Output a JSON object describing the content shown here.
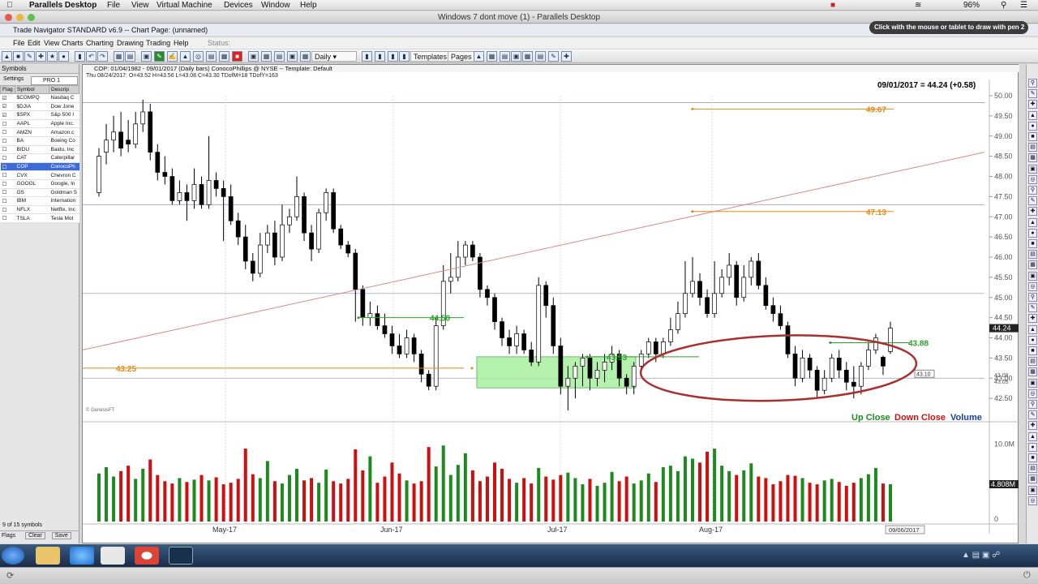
{
  "mac_menubar": {
    "app": "Parallels Desktop",
    "items": [
      "File",
      "View",
      "Virtual Machine",
      "Devices",
      "Window",
      "Help"
    ],
    "battery": "96%"
  },
  "parallels": {
    "window_title": "Windows 7 dont move (1) - Parallels Desktop"
  },
  "tn": {
    "title": "Trade Navigator STANDARD v6.9  --  Chart Page: (unnamed)",
    "hint": "Click with the mouse or tablet to draw with pen 2",
    "menus": [
      "File",
      "Edit",
      "View",
      "Charts",
      "Charting",
      "Drawing",
      "Trading",
      "Help"
    ],
    "status_label": "Status:",
    "period": "Daily",
    "templates_label": "Templates",
    "pages_label": "Pages"
  },
  "left_panel": {
    "header": "Symbols",
    "settings_label": "Settings",
    "list_name": "PRO 1",
    "columns": [
      "Flag",
      "Symbol",
      "Descrip"
    ],
    "rows": [
      {
        "symbol": "$COMPQ",
        "desc": "Nasdaq C",
        "flag": "☑"
      },
      {
        "symbol": "$DJIA",
        "desc": "Dow Jone",
        "flag": "☑"
      },
      {
        "symbol": "$SPX",
        "desc": "S&p 500 I",
        "flag": "☑"
      },
      {
        "symbol": "AAPL",
        "desc": "Apple Inc.",
        "flag": "☐"
      },
      {
        "symbol": "AMZN",
        "desc": "Amazon.c",
        "flag": "☐"
      },
      {
        "symbol": "BA",
        "desc": "Boeing Co",
        "flag": "☐"
      },
      {
        "symbol": "BIDU",
        "desc": "Baidu, Inc",
        "flag": "☐"
      },
      {
        "symbol": "CAT",
        "desc": "Caterpillar",
        "flag": "☐"
      },
      {
        "symbol": "COP",
        "desc": "ConocoPh",
        "flag": "☐"
      },
      {
        "symbol": "CVX",
        "desc": "Chevron C",
        "flag": "☐"
      },
      {
        "symbol": "GOOGL",
        "desc": "Google, In",
        "flag": "☐"
      },
      {
        "symbol": "GS",
        "desc": "Goldman S",
        "flag": "☐"
      },
      {
        "symbol": "IBM",
        "desc": "Internation",
        "flag": "☐"
      },
      {
        "symbol": "NFLX",
        "desc": "Netflix, Inc",
        "flag": "☐"
      },
      {
        "symbol": "TSLA",
        "desc": "Tesla Mot",
        "flag": "☐"
      }
    ],
    "selected_index": 8,
    "count_text": "9 of 15 symbols",
    "footer_buttons": [
      "Flags",
      "Clear",
      "Save"
    ]
  },
  "chart_window": {
    "header": "COP: 01/04/1982 - 09/01/2017 (Daily bars)  ConocoPhillips @ NYSE  --  Template: Default",
    "bar_info": "Thu  08/24/2017: O=43.52  H=43.56  L=43.08  C=43.30  TDofM=18  TDofY=163",
    "last_price_label": "09/01/2017 = 44.24 (+0.58)",
    "copyright": "© GenesisFT",
    "volume_legend": [
      "Up Close",
      "Down Close",
      "Volume"
    ],
    "date_readout": "09/06/2017"
  },
  "chart_data": {
    "type": "candlestick",
    "symbol": "COP",
    "price_axis": {
      "min": 42.0,
      "max": 50.0,
      "ticks": [
        "50.00",
        "49.50",
        "49.00",
        "48.50",
        "48.00",
        "47.50",
        "47.00",
        "46.50",
        "46.00",
        "45.50",
        "45.00",
        "44.50",
        "44.00",
        "43.50",
        "43.00",
        "42.50"
      ]
    },
    "x_ticks": [
      "May-17",
      "Jun-17",
      "Jul-17",
      "Aug-17"
    ],
    "last_price_tag": "44.24",
    "horizontal_levels": [
      {
        "label": "49.67",
        "value": 49.67,
        "color": "#e58a1a"
      },
      {
        "label": "47.13",
        "value": 47.13,
        "color": "#e58a1a"
      },
      {
        "label": "44.50",
        "value": 44.5,
        "color": "#2aa52a"
      },
      {
        "label": "43.25",
        "value": 43.25,
        "color": "#e58a1a"
      },
      {
        "label": "43.53",
        "value": 43.53,
        "color": "#2aa52a"
      },
      {
        "label": "43.88",
        "value": 43.88,
        "color": "#2aa52a"
      }
    ],
    "price_tags": [
      "43.10",
      "43.09",
      "43.05"
    ],
    "volume_axis": {
      "ticks": [
        "10.0M",
        "0"
      ],
      "last_volume_tag": "4.808M"
    },
    "colors": {
      "up": "#1e8a1e",
      "down": "#cc1010",
      "candle_up": "#ffffff",
      "candle_down": "#000000",
      "trendline": "#d88a8a",
      "ellipse": "#a83030",
      "zone": "#a8f0a0"
    },
    "candles": [
      [
        47.6,
        48.5,
        47.5,
        48.7
      ],
      [
        48.6,
        48.9,
        48.3,
        49.3
      ],
      [
        48.9,
        49.1,
        48.6,
        49.5
      ],
      [
        49.1,
        48.7,
        48.5,
        49.6
      ],
      [
        48.9,
        48.8,
        48.6,
        49.4
      ],
      [
        48.8,
        49.3,
        48.7,
        49.6
      ],
      [
        49.3,
        49.6,
        49.1,
        49.9
      ],
      [
        49.6,
        48.6,
        48.4,
        49.8
      ],
      [
        48.6,
        48.1,
        47.9,
        48.8
      ],
      [
        48.1,
        48.0,
        47.8,
        48.5
      ],
      [
        48.0,
        47.4,
        47.3,
        48.2
      ],
      [
        47.4,
        47.6,
        47.3,
        47.9
      ],
      [
        47.6,
        47.4,
        46.9,
        47.8
      ],
      [
        47.4,
        47.8,
        47.2,
        48.2
      ],
      [
        47.8,
        47.3,
        47.2,
        48.0
      ],
      [
        47.3,
        47.9,
        47.2,
        49.0
      ],
      [
        47.9,
        47.7,
        47.5,
        48.1
      ],
      [
        47.7,
        47.5,
        46.4,
        47.9
      ],
      [
        47.5,
        46.9,
        46.8,
        47.8
      ],
      [
        46.9,
        46.5,
        46.3,
        47.1
      ],
      [
        46.5,
        45.9,
        45.7,
        46.8
      ],
      [
        45.9,
        45.6,
        45.4,
        46.1
      ],
      [
        45.6,
        46.3,
        45.5,
        46.6
      ],
      [
        46.3,
        46.6,
        46.1,
        46.8
      ],
      [
        46.6,
        46.0,
        45.8,
        46.9
      ],
      [
        46.0,
        46.8,
        45.9,
        47.3
      ],
      [
        46.8,
        47.0,
        46.6,
        47.2
      ],
      [
        47.0,
        47.5,
        46.9,
        48.0
      ],
      [
        47.5,
        46.6,
        46.4,
        47.6
      ],
      [
        46.6,
        46.2,
        45.9,
        46.8
      ],
      [
        46.2,
        47.1,
        46.1,
        47.2
      ],
      [
        47.1,
        47.6,
        46.9,
        47.7
      ],
      [
        47.6,
        46.7,
        46.6,
        47.7
      ],
      [
        46.7,
        46.3,
        46.2,
        46.8
      ],
      [
        46.3,
        46.1,
        46.0,
        46.4
      ],
      [
        46.1,
        45.2,
        44.4,
        46.2
      ],
      [
        45.2,
        44.5,
        44.3,
        45.3
      ],
      [
        44.5,
        44.6,
        44.3,
        44.9
      ],
      [
        44.6,
        44.3,
        44.2,
        44.8
      ],
      [
        44.3,
        44.1,
        44.0,
        44.6
      ],
      [
        44.1,
        43.8,
        43.6,
        44.3
      ],
      [
        43.8,
        43.6,
        43.5,
        44.1
      ],
      [
        43.6,
        44.0,
        43.5,
        44.2
      ],
      [
        44.0,
        43.6,
        43.4,
        44.1
      ],
      [
        43.6,
        43.1,
        42.9,
        43.7
      ],
      [
        43.1,
        42.8,
        42.7,
        43.2
      ],
      [
        42.8,
        44.3,
        42.7,
        44.5
      ],
      [
        44.3,
        45.4,
        44.2,
        45.8
      ],
      [
        45.4,
        45.5,
        45.1,
        46.1
      ],
      [
        45.5,
        46.0,
        45.4,
        46.4
      ],
      [
        46.0,
        46.3,
        45.8,
        46.4
      ],
      [
        46.3,
        46.0,
        45.9,
        46.4
      ],
      [
        46.0,
        45.2,
        45.0,
        46.1
      ],
      [
        45.2,
        45.0,
        44.8,
        45.3
      ],
      [
        45.0,
        44.4,
        44.2,
        45.1
      ],
      [
        44.4,
        44.0,
        43.8,
        44.5
      ],
      [
        44.0,
        43.8,
        43.6,
        44.2
      ],
      [
        43.8,
        44.1,
        43.6,
        44.3
      ],
      [
        44.1,
        43.7,
        43.6,
        44.2
      ],
      [
        43.7,
        43.4,
        43.3,
        43.9
      ],
      [
        43.4,
        45.3,
        43.3,
        45.5
      ],
      [
        45.3,
        44.8,
        44.5,
        45.4
      ],
      [
        44.8,
        43.8,
        43.6,
        45.0
      ],
      [
        43.8,
        42.8,
        42.6,
        44.0
      ],
      [
        42.8,
        43.0,
        42.2,
        43.3
      ],
      [
        43.0,
        43.3,
        42.5,
        43.4
      ],
      [
        43.3,
        43.5,
        42.8,
        43.6
      ],
      [
        43.5,
        43.0,
        42.7,
        43.6
      ],
      [
        43.0,
        43.2,
        42.8,
        43.4
      ],
      [
        43.2,
        43.4,
        42.9,
        43.6
      ],
      [
        43.4,
        43.6,
        43.2,
        43.8
      ],
      [
        43.6,
        43.0,
        42.8,
        43.7
      ],
      [
        43.0,
        42.8,
        42.6,
        43.1
      ],
      [
        42.8,
        43.3,
        42.6,
        43.4
      ],
      [
        43.3,
        43.6,
        43.2,
        43.7
      ],
      [
        43.6,
        43.9,
        43.5,
        44.0
      ],
      [
        43.9,
        43.6,
        43.4,
        44.0
      ],
      [
        43.6,
        43.9,
        43.5,
        44.0
      ],
      [
        43.9,
        44.2,
        43.8,
        44.5
      ],
      [
        44.2,
        44.6,
        44.1,
        44.9
      ],
      [
        44.6,
        45.1,
        44.5,
        45.9
      ],
      [
        45.1,
        45.4,
        45.0,
        46.0
      ],
      [
        45.4,
        45.0,
        44.8,
        45.6
      ],
      [
        45.0,
        44.6,
        44.5,
        45.2
      ],
      [
        44.6,
        45.1,
        44.5,
        45.9
      ],
      [
        45.1,
        45.5,
        45.0,
        45.7
      ],
      [
        45.5,
        45.8,
        45.3,
        46.1
      ],
      [
        45.8,
        45.0,
        44.8,
        45.9
      ],
      [
        45.0,
        45.5,
        44.9,
        45.8
      ],
      [
        45.5,
        45.9,
        45.3,
        46.0
      ],
      [
        45.9,
        45.3,
        45.2,
        46.1
      ],
      [
        45.3,
        44.8,
        44.7,
        45.5
      ],
      [
        44.8,
        44.6,
        44.4,
        45.0
      ],
      [
        44.6,
        44.3,
        44.2,
        44.8
      ],
      [
        44.3,
        43.6,
        43.5,
        44.4
      ],
      [
        43.6,
        43.0,
        42.8,
        43.8
      ],
      [
        43.0,
        43.5,
        42.9,
        43.7
      ],
      [
        43.5,
        43.2,
        43.0,
        43.6
      ],
      [
        43.2,
        42.7,
        42.5,
        43.3
      ],
      [
        42.7,
        43.0,
        42.6,
        43.2
      ],
      [
        43.0,
        43.5,
        42.9,
        43.6
      ],
      [
        43.5,
        43.2,
        43.0,
        43.7
      ],
      [
        43.2,
        42.9,
        42.7,
        43.4
      ],
      [
        42.9,
        42.8,
        42.5,
        43.3
      ],
      [
        42.8,
        43.3,
        42.6,
        43.4
      ],
      [
        43.3,
        43.7,
        43.2,
        43.9
      ],
      [
        43.7,
        44.0,
        43.6,
        44.1
      ],
      [
        43.52,
        43.3,
        43.08,
        43.56
      ],
      [
        43.66,
        44.24,
        43.6,
        44.4
      ]
    ],
    "volumes_m": [
      6.2,
      7.0,
      5.8,
      6.5,
      7.2,
      5.5,
      6.8,
      8.0,
      6.0,
      5.2,
      4.9,
      5.6,
      5.1,
      5.4,
      6.0,
      5.3,
      5.7,
      4.8,
      5.0,
      5.5,
      9.4,
      6.1,
      5.6,
      7.8,
      5.2,
      4.9,
      6.0,
      6.8,
      5.3,
      5.6,
      5.0,
      6.7,
      5.2,
      4.9,
      5.5,
      9.3,
      6.6,
      8.4,
      5.0,
      5.8,
      7.6,
      6.2,
      5.3,
      4.9,
      5.2,
      9.6,
      7.1,
      9.8,
      6.0,
      7.3,
      8.8,
      6.6,
      5.2,
      5.8,
      7.6,
      6.8,
      5.5,
      5.0,
      5.6,
      4.9,
      6.9,
      5.8,
      5.4,
      6.0,
      6.3,
      5.6,
      4.8,
      5.5,
      4.6,
      5.0,
      6.4,
      5.2,
      5.8,
      4.9,
      5.3,
      6.2,
      5.1,
      7.0,
      7.2,
      6.5,
      8.4,
      8.1,
      7.6,
      9.0,
      9.4,
      7.2,
      6.5,
      6.0,
      6.6,
      7.5,
      5.8,
      5.6,
      4.8,
      5.2,
      6.0,
      5.9,
      5.6,
      5.0,
      4.8,
      5.3,
      5.5,
      5.1,
      4.6,
      5.0,
      5.6,
      6.1,
      6.9,
      4.9,
      4.808
    ]
  }
}
